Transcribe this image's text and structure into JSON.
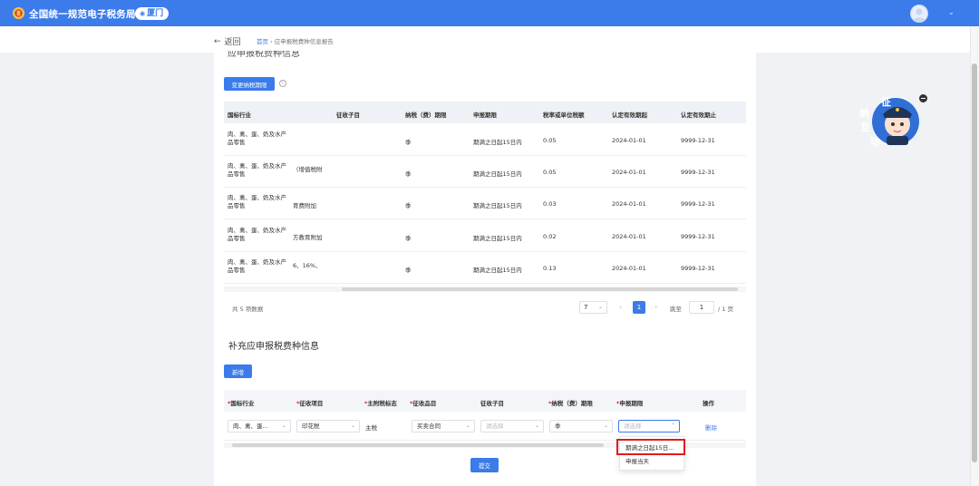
{
  "header": {
    "site_title": "全国统一规范电子税务局",
    "city": "厦门",
    "pin_glyph": "◉",
    "caret": "⌄"
  },
  "nav": {
    "back_arrow": "←",
    "back_label": "返回",
    "breadcrumb_home": "首页",
    "breadcrumb_sep": "›",
    "breadcrumb_current": "应申报税费种信息报告"
  },
  "section1": {
    "title": "应申报税费种信息",
    "change_button": "变更纳税期限",
    "info_glyph": "i",
    "columns": [
      "国标行业",
      "征收子目",
      "纳税（费）期限",
      "申报期限",
      "税率或单位税额",
      "认定有效期起",
      "认定有效期止"
    ],
    "rows": [
      {
        "industry": "肉、禽、蛋、奶及水产品零售",
        "subitem": "",
        "period": "季",
        "deadline": "期满之日起15日内",
        "rate": "0.05",
        "start": "2024-01-01",
        "end": "9999-12-31"
      },
      {
        "industry": "肉、禽、蛋、奶及水产品零售",
        "subitem": "（增值税附",
        "period": "季",
        "deadline": "期满之日起15日内",
        "rate": "0.05",
        "start": "2024-01-01",
        "end": "9999-12-31"
      },
      {
        "industry": "肉、禽、蛋、奶及水产品零售",
        "subitem": "育费附加",
        "period": "季",
        "deadline": "期满之日起15日内",
        "rate": "0.03",
        "start": "2024-01-01",
        "end": "9999-12-31"
      },
      {
        "industry": "肉、禽、蛋、奶及水产品零售",
        "subitem": "方教育附加",
        "period": "季",
        "deadline": "期满之日起15日内",
        "rate": "0.02",
        "start": "2024-01-01",
        "end": "9999-12-31"
      },
      {
        "industry": "肉、禽、蛋、奶及水产品零售",
        "subitem": "6、16%、",
        "period": "季",
        "deadline": "期满之日起15日内",
        "rate": "0.13",
        "start": "2024-01-01",
        "end": "9999-12-31"
      }
    ]
  },
  "pagination": {
    "total_text": "共 5 项数据",
    "page_size": "7",
    "prev": "‹",
    "current_page": "1",
    "next": "›",
    "goto_label": "跳至",
    "goto_value": "1",
    "total_pages": "/ 1 页",
    "caret": "⌄"
  },
  "section2": {
    "title": "补充应申报税费种信息",
    "add_button": "新增",
    "required_mark": "*",
    "columns": [
      {
        "label": "国标行业",
        "required": true
      },
      {
        "label": "征收项目",
        "required": true
      },
      {
        "label": "主附税标志",
        "required": true
      },
      {
        "label": "征收品目",
        "required": true
      },
      {
        "label": "征收子目",
        "required": false
      },
      {
        "label": "纳税（费）期限",
        "required": true
      },
      {
        "label": "申报期限",
        "required": true
      },
      {
        "label": "操作",
        "required": false
      }
    ],
    "row": {
      "industry": "肉、禽、蛋...",
      "project": "印花税",
      "flag": "主税",
      "item": "买卖合同",
      "subitem_placeholder": "请选择",
      "period": "季",
      "deadline_placeholder": "请选择",
      "action": "删除"
    },
    "caret": "⌄",
    "caret_up": "⌃",
    "dropdown_options": [
      "期满之日起15日...",
      "申报当天"
    ],
    "submit_button": "提交"
  },
  "mascot": {
    "text_chars": [
      "征",
      "纳",
      "互",
      "动"
    ]
  },
  "colors": {
    "primary": "#3b7bea",
    "highlight": "#e01c1c",
    "required": "#e02020"
  }
}
